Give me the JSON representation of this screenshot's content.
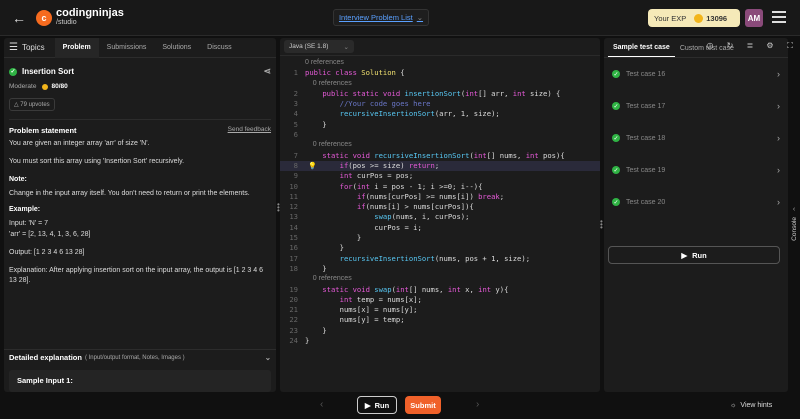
{
  "header": {
    "brand": "codingninjas",
    "brand_sub": "/studio",
    "problem_list": "Interview Problem List",
    "exp_label": "Your EXP",
    "exp_points": "13096",
    "avatar": "AM"
  },
  "left_tabs": {
    "topics": "Topics",
    "problem": "Problem",
    "submissions": "Submissions",
    "solutions": "Solutions",
    "discuss": "Discuss"
  },
  "problem": {
    "title": "Insertion Sort",
    "difficulty": "Moderate",
    "score": "80/80",
    "upvotes": "79 upvotes",
    "statement_heading": "Problem statement",
    "send_feedback": "Send feedback",
    "line1": "You are given an integer array 'arr' of size 'N'.",
    "line2": "You must sort this array using 'Insertion Sort' recursively.",
    "note_heading": "Note:",
    "note": "Change in the input array itself. You don't need to return or print the elements.",
    "example_heading": "Example:",
    "ex_input_n": "Input: 'N' = 7",
    "ex_input_arr": "'arr' = [2, 13, 4, 1, 3, 6, 28]",
    "ex_output": "Output: [1 2 3 4 6 13 28]",
    "ex_explanation": "Explanation: After applying insertion sort on the input array, the output is [1 2 3 4 6 13 28].",
    "detailed_heading": "Detailed explanation",
    "detailed_sub": "( Input/output format, Notes, Images )",
    "sample_input": "Sample Input 1:"
  },
  "editor": {
    "language": "Java (SE 1.8)",
    "lines": [
      {
        "n": "",
        "t": "0 references",
        "ref": true
      },
      {
        "n": "1",
        "t": "public class Solution {"
      },
      {
        "n": "",
        "t": "    0 references",
        "ref": true
      },
      {
        "n": "2",
        "t": "    public static void insertionSort(int[] arr, int size) {"
      },
      {
        "n": "3",
        "t": "        //Your code goes here"
      },
      {
        "n": "4",
        "t": "        recursiveInsertionSort(arr, 1, size);"
      },
      {
        "n": "5",
        "t": "    }"
      },
      {
        "n": "6",
        "t": ""
      },
      {
        "n": "",
        "t": "    0 references",
        "ref": true
      },
      {
        "n": "7",
        "t": "    static void recursiveInsertionSort(int[] nums, int pos){"
      },
      {
        "n": "8",
        "t": "        if(pos >= size) return;",
        "hl": true
      },
      {
        "n": "9",
        "t": "        int curPos = pos;"
      },
      {
        "n": "10",
        "t": "        for(int i = pos - 1; i >=0; i--){"
      },
      {
        "n": "11",
        "t": "            if(nums[curPos] >= nums[i]) break;"
      },
      {
        "n": "12",
        "t": "            if(nums[i] > nums[curPos]){"
      },
      {
        "n": "13",
        "t": "                swap(nums, i, curPos);"
      },
      {
        "n": "14",
        "t": "                curPos = i;"
      },
      {
        "n": "15",
        "t": "            }"
      },
      {
        "n": "16",
        "t": "        }"
      },
      {
        "n": "17",
        "t": "        recursiveInsertionSort(nums, pos + 1, size);"
      },
      {
        "n": "18",
        "t": "    }"
      },
      {
        "n": "",
        "t": "    0 references",
        "ref": true
      },
      {
        "n": "19",
        "t": "    static void swap(int[] nums, int x, int y){"
      },
      {
        "n": "20",
        "t": "        int temp = nums[x];"
      },
      {
        "n": "21",
        "t": "        nums[x] = nums[y];"
      },
      {
        "n": "22",
        "t": "        nums[y] = temp;"
      },
      {
        "n": "23",
        "t": "    }"
      },
      {
        "n": "24",
        "t": "}"
      }
    ]
  },
  "tests": {
    "sample_tab": "Sample test case",
    "custom_tab": "Custom test case",
    "cases": [
      "Test case 16",
      "Test case 17",
      "Test case 18",
      "Test case 19",
      "Test case 20"
    ],
    "run": "Run",
    "console": "Console"
  },
  "bottom": {
    "run": "Run",
    "submit": "Submit",
    "hints": "View hints"
  },
  "colors": {
    "accent": "#f0612a",
    "success": "#2fb344",
    "link": "#5aa0ff"
  }
}
